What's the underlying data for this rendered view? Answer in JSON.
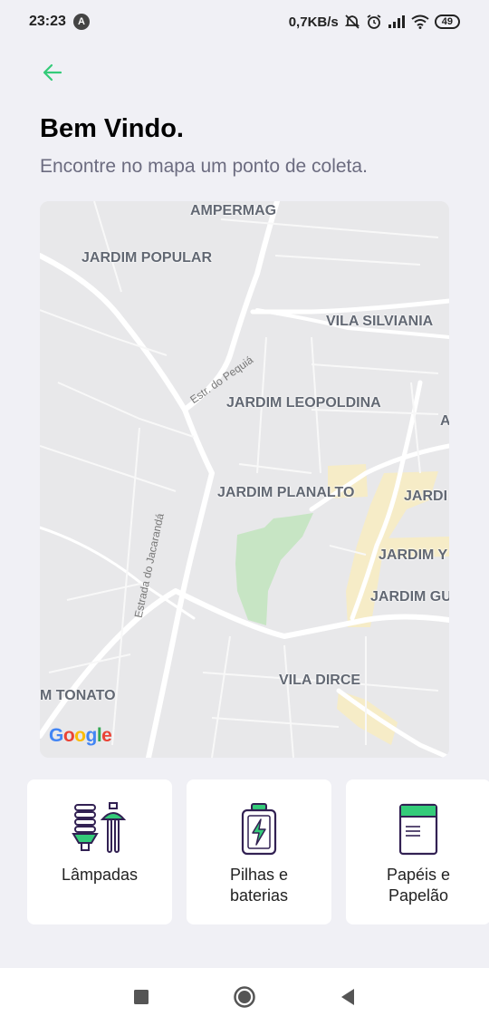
{
  "status_bar": {
    "time": "23:23",
    "notification_badge": "A",
    "network_speed": "0,7KB/s",
    "battery_level": "49",
    "icons": [
      "mute-icon",
      "alarm-icon",
      "signal-icon",
      "wifi-icon",
      "battery-icon"
    ]
  },
  "header": {
    "back_icon": "arrow-left-icon",
    "title": "Bem Vindo.",
    "subtitle": "Encontre no mapa um ponto de coleta."
  },
  "map": {
    "neighborhoods": [
      "AMPERMAG",
      "JARDIM POPULAR",
      "VILA SILVIANIA",
      "JARDIM\nLEOPOLDINA",
      "JARDIM\nPLANALTO",
      "JARDI\nSUC",
      "JARDIM Y",
      "JARDIM\nGUIOMAR",
      "VILA DIRCE",
      "M TONATO",
      "A"
    ],
    "roads": [
      "Estr. do Pequiá",
      "Estrada do Jacarandá"
    ],
    "attribution": "Google",
    "attribution_letters": [
      "G",
      "o",
      "o",
      "g",
      "l",
      "e"
    ],
    "attribution_colors": [
      "#4285F4",
      "#EA4335",
      "#FBBC05",
      "#4285F4",
      "#34A853",
      "#EA4335"
    ]
  },
  "items": [
    {
      "label": "Lâmpadas",
      "icon": "lamps-icon"
    },
    {
      "label": "Pilhas e\nbaterias",
      "icon": "battery-icon"
    },
    {
      "label": "Papéis e\nPapelão",
      "icon": "paper-icon"
    }
  ],
  "navigation": {
    "recent_icon": "square-icon",
    "home_icon": "circle-icon",
    "back_icon": "triangle-back-icon"
  },
  "colors": {
    "accent": "#34CB79",
    "title": "#000000",
    "subtitle": "#6C6C80",
    "background": "#F0F0F5"
  }
}
